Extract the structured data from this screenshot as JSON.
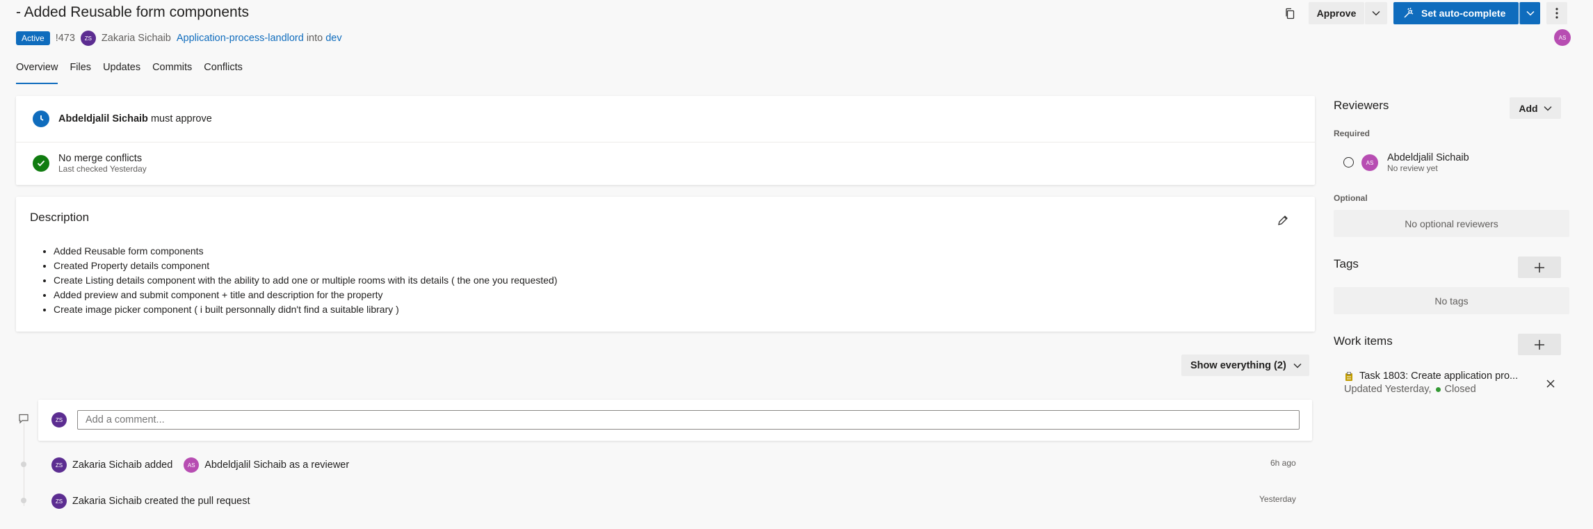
{
  "header": {
    "title": "- Added Reusable form components",
    "status": "Active",
    "pr_id": "!473",
    "author": "Zakaria Sichaib",
    "author_initials": "ZS",
    "source_branch": "Application-process-landlord",
    "into": "into",
    "target_branch": "dev",
    "approve_label": "Approve",
    "autocomplete_label": "Set auto-complete",
    "reviewer_initials": "AS"
  },
  "tabs": [
    "Overview",
    "Files",
    "Updates",
    "Commits",
    "Conflicts"
  ],
  "status_checks": {
    "approval_name": "Abdeldjalil Sichaib",
    "approval_text": "must approve",
    "merge_title": "No merge conflicts",
    "merge_sub": "Last checked Yesterday"
  },
  "description": {
    "heading": "Description",
    "items": [
      "Added Reusable form components",
      "Created Property details component",
      "Create Listing details component with the ability to add one or multiple rooms with its details ( the one you requested)",
      "Added preview and submit component + title and description for the property",
      "Create image picker component ( i built personnally didn't find a suitable library )"
    ]
  },
  "activity": {
    "filter_label": "Show everything (2)",
    "comment_placeholder": "Add a comment...",
    "events": [
      {
        "actor": "Zakaria Sichaib",
        "verb": "added",
        "target": "Abdeldjalil Sichaib",
        "suffix": "as a reviewer",
        "time": "6h ago"
      },
      {
        "actor": "Zakaria Sichaib",
        "text": "created the pull request",
        "time": "Yesterday"
      }
    ]
  },
  "sidebar": {
    "reviewers_heading": "Reviewers",
    "add_label": "Add",
    "required_label": "Required",
    "reviewer_name": "Abdeldjalil Sichaib",
    "reviewer_status": "No review yet",
    "optional_label": "Optional",
    "no_optional": "No optional reviewers",
    "tags_heading": "Tags",
    "no_tags": "No tags",
    "work_items_heading": "Work items",
    "work_item_title": "Task 1803: Create application pro...",
    "work_item_updated": "Updated Yesterday,",
    "work_item_state": "Closed"
  },
  "colors": {
    "accent": "#0f6cbd",
    "success": "#107c10",
    "author_avatar": "#5c2d91",
    "reviewer_avatar": "#b74db2"
  }
}
